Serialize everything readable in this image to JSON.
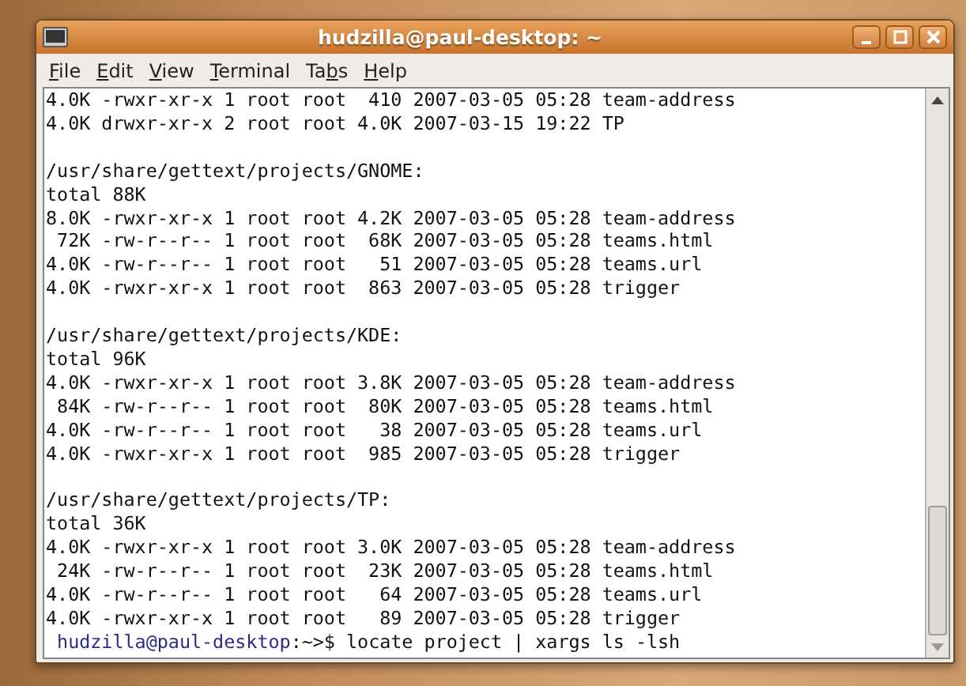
{
  "window": {
    "title": "hudzilla@paul-desktop: ~"
  },
  "menu": [
    {
      "access_key": "F",
      "label_end": "ile"
    },
    {
      "access_key": "E",
      "label_end": "dit"
    },
    {
      "access_key": "V",
      "label_end": "iew"
    },
    {
      "access_key": "T",
      "label_end": "erminal"
    },
    {
      "label_start": "Ta",
      "access_key": "b",
      "label_end": "s"
    },
    {
      "access_key": "H",
      "label_end": "elp"
    }
  ],
  "terminal": {
    "blocks": [
      {
        "lines": [
          "4.0K -rwxr-xr-x 1 root root  410 2007-03-05 05:28 team-address",
          "4.0K drwxr-xr-x 2 root root 4.0K 2007-03-15 19:22 TP"
        ]
      },
      {
        "lines": [
          "/usr/share/gettext/projects/GNOME:",
          "total 88K",
          "8.0K -rwxr-xr-x 1 root root 4.2K 2007-03-05 05:28 team-address",
          " 72K -rw-r--r-- 1 root root  68K 2007-03-05 05:28 teams.html",
          "4.0K -rw-r--r-- 1 root root   51 2007-03-05 05:28 teams.url",
          "4.0K -rwxr-xr-x 1 root root  863 2007-03-05 05:28 trigger"
        ]
      },
      {
        "lines": [
          "/usr/share/gettext/projects/KDE:",
          "total 96K",
          "4.0K -rwxr-xr-x 1 root root 3.8K 2007-03-05 05:28 team-address",
          " 84K -rw-r--r-- 1 root root  80K 2007-03-05 05:28 teams.html",
          "4.0K -rw-r--r-- 1 root root   38 2007-03-05 05:28 teams.url",
          "4.0K -rwxr-xr-x 1 root root  985 2007-03-05 05:28 trigger"
        ]
      },
      {
        "lines": [
          "/usr/share/gettext/projects/TP:",
          "total 36K",
          "4.0K -rwxr-xr-x 1 root root 3.0K 2007-03-05 05:28 team-address",
          " 24K -rw-r--r-- 1 root root  23K 2007-03-05 05:28 teams.html",
          "4.0K -rw-r--r-- 1 root root   64 2007-03-05 05:28 teams.url",
          "4.0K -rwxr-xr-x 1 root root   89 2007-03-05 05:28 trigger"
        ]
      }
    ],
    "prompt": {
      "user_host": "hudzilla@paul-desktop",
      "command": ":~>$ locate project | xargs ls -lsh"
    }
  }
}
